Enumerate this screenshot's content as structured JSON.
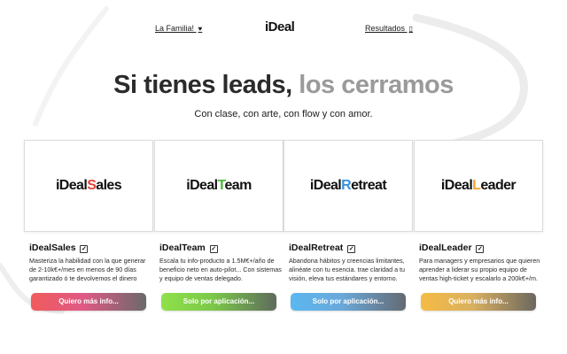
{
  "nav": {
    "left_label": "La Familia!",
    "left_icon": "♥",
    "right_label": "Resultados",
    "right_icon": "▯",
    "logo": "iDeal"
  },
  "hero": {
    "title_dark": "Si tienes leads,",
    "title_light": "los cerramos",
    "subtitle": "Con clase, con arte, con flow y con amor."
  },
  "colors": {
    "sales": "#e0443a",
    "team": "#4bb83b",
    "retreat": "#3a8fd9",
    "leader": "#f0a52a"
  },
  "cards": [
    {
      "logo_prefix": "iDeal",
      "logo_accent": "S",
      "logo_rest": "ales",
      "title": "iDealSales",
      "check_icon": "☑",
      "description": "Masteriza la habilidad con la que generar de 2-10k€+/mes en menos de 90 días garantizado ó te devolvemos el dinero",
      "button": "Quiero más info..."
    },
    {
      "logo_prefix": "iDeal",
      "logo_accent": "T",
      "logo_rest": "eam",
      "title": "iDealTeam",
      "check_icon": "☑",
      "description": "Escala tu info-producto a 1.5M€+/año de beneficio neto en auto-pilot... Con sistemas y equipo de ventas delegado.",
      "button": "Solo por aplicación..."
    },
    {
      "logo_prefix": "iDeal",
      "logo_accent": "R",
      "logo_rest": "etreat",
      "title": "iDealRetreat",
      "check_icon": "☑",
      "description": "Abandona hábitos y creencias limitantes, alinéate con tu esencia. trae claridad a tu visión, eleva tus estándares y entorno.",
      "button": "Solo por aplicación..."
    },
    {
      "logo_prefix": "iDeal",
      "logo_accent": "L",
      "logo_rest": "eader",
      "title": "iDealLeader",
      "check_icon": "☑",
      "description": "Para managers y empresarios que quieren aprender a liderar su propio equipo de ventas high-ticket y escalarlo a 200k€+/m.",
      "button": "Quiero más info..."
    }
  ]
}
